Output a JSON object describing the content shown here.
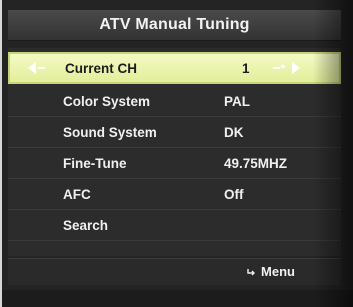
{
  "title": "ATV Manual Tuning",
  "colors": {
    "panel_bg": "#242424",
    "highlight": "#e9f2a8",
    "text": "#f0f0f0"
  },
  "items": [
    {
      "label": "Current CH",
      "value": "1"
    },
    {
      "label": "Color System",
      "value": "PAL"
    },
    {
      "label": "Sound System",
      "value": "DK"
    },
    {
      "label": "Fine-Tune",
      "value": "49.75MHZ"
    },
    {
      "label": "AFC",
      "value": "Off"
    },
    {
      "label": "Search",
      "value": ""
    }
  ],
  "footer": {
    "icon": "return-icon",
    "label": "Menu"
  }
}
